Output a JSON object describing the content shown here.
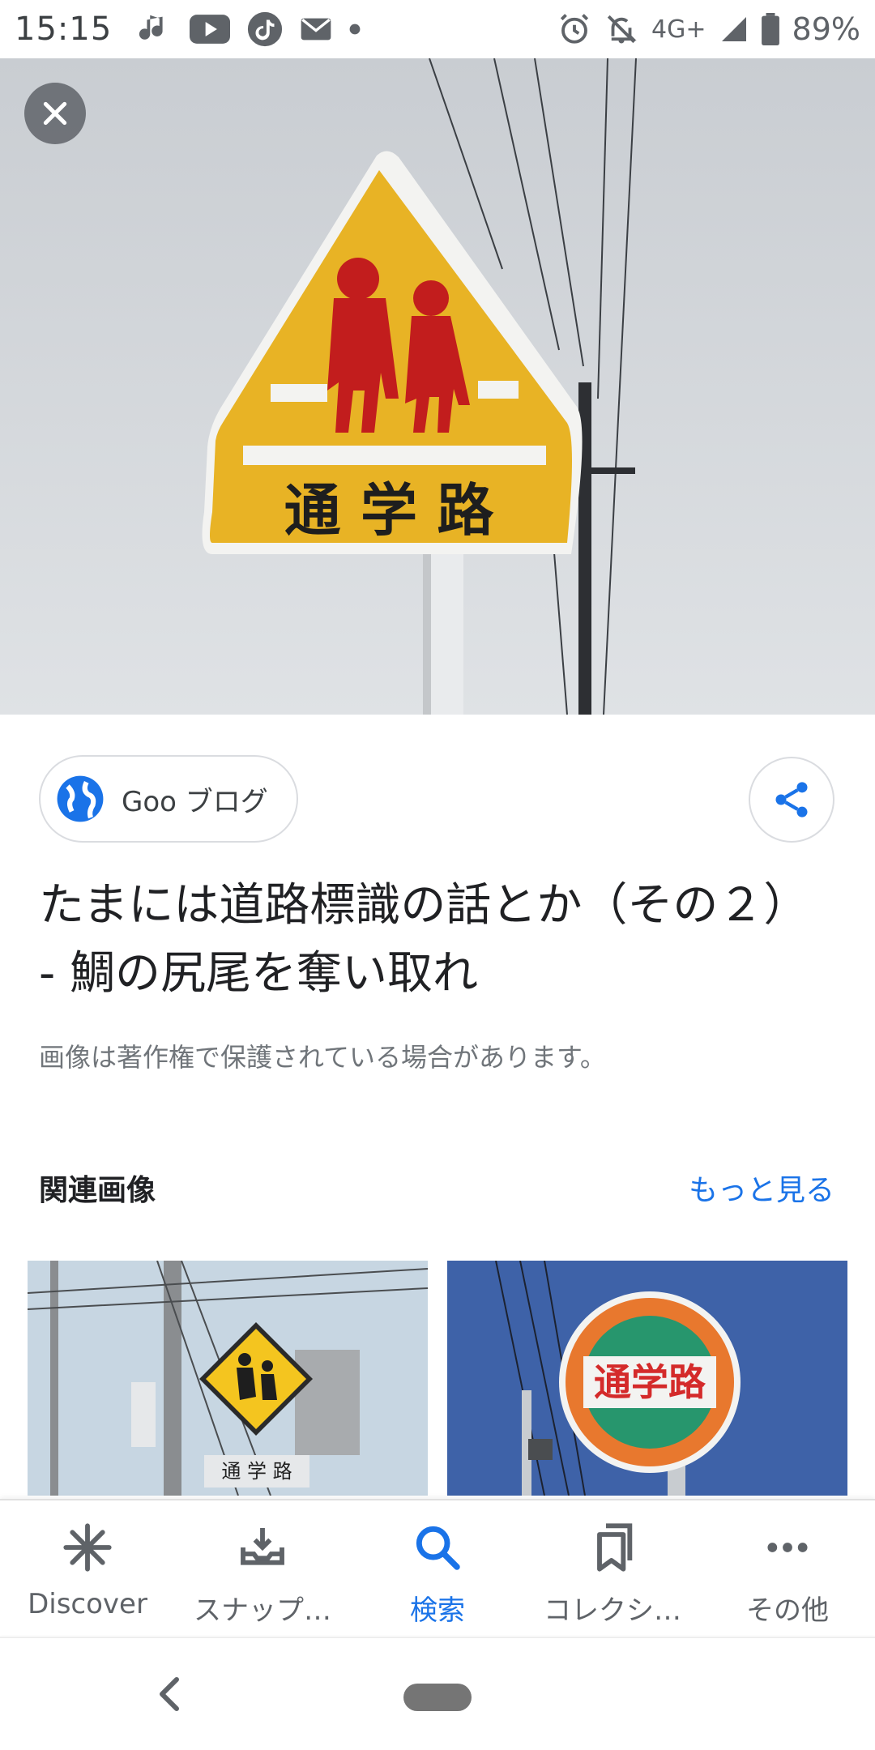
{
  "status_bar": {
    "time": "15:15",
    "network": "4G+",
    "battery": "89%",
    "icons": [
      "music-note-icon",
      "youtube-icon",
      "tiktok-icon",
      "mail-icon",
      "dot-icon",
      "alarm-icon",
      "mute-icon",
      "signal-icon",
      "battery-icon"
    ]
  },
  "hero": {
    "sign_text": "通 学 路"
  },
  "source": {
    "label": "Goo ブログ",
    "icon": "globe-icon"
  },
  "share": {
    "icon": "share-icon"
  },
  "result": {
    "title": "たまには道路標識の話とか（その２） - 鯛の尻尾を奪い取れ",
    "copyright": "画像は著作権で保護されている場合があります。"
  },
  "related": {
    "header": "関連画像",
    "more": "もっと見る",
    "thumb1_sign_text": "通 学 路",
    "thumb2_sign_text": "通学路"
  },
  "bottom_nav": {
    "items": [
      {
        "label": "Discover",
        "icon": "asterisk-icon"
      },
      {
        "label": "スナップ…",
        "icon": "tray-icon"
      },
      {
        "label": "検索",
        "icon": "search-icon"
      },
      {
        "label": "コレクシ…",
        "icon": "bookmarks-icon"
      },
      {
        "label": "その他",
        "icon": "more-horiz-icon"
      }
    ],
    "active_index": 2
  },
  "colors": {
    "accent": "#1a73e8",
    "sign_yellow": "#e8b325",
    "sign_red": "#c21d1d",
    "sky": "#d4d8dc"
  }
}
